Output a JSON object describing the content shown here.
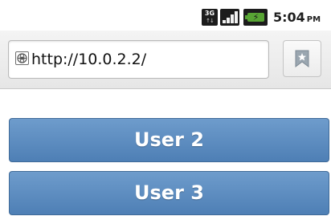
{
  "status_bar": {
    "network_type": "3G",
    "network_sub": "↑↓",
    "time": "5:04",
    "ampm": "PM",
    "icons": [
      "3g-data-icon",
      "signal-strength-icon",
      "battery-charging-icon"
    ],
    "battery_color": "#58a534"
  },
  "browser": {
    "url": "http://10.0.2.2/",
    "icons": [
      "globe-page-icon",
      "bookmark-icon"
    ]
  },
  "page": {
    "buttons": [
      {
        "label": "User 2"
      },
      {
        "label": "User 3"
      }
    ],
    "button_color": "#5b8bc0"
  }
}
